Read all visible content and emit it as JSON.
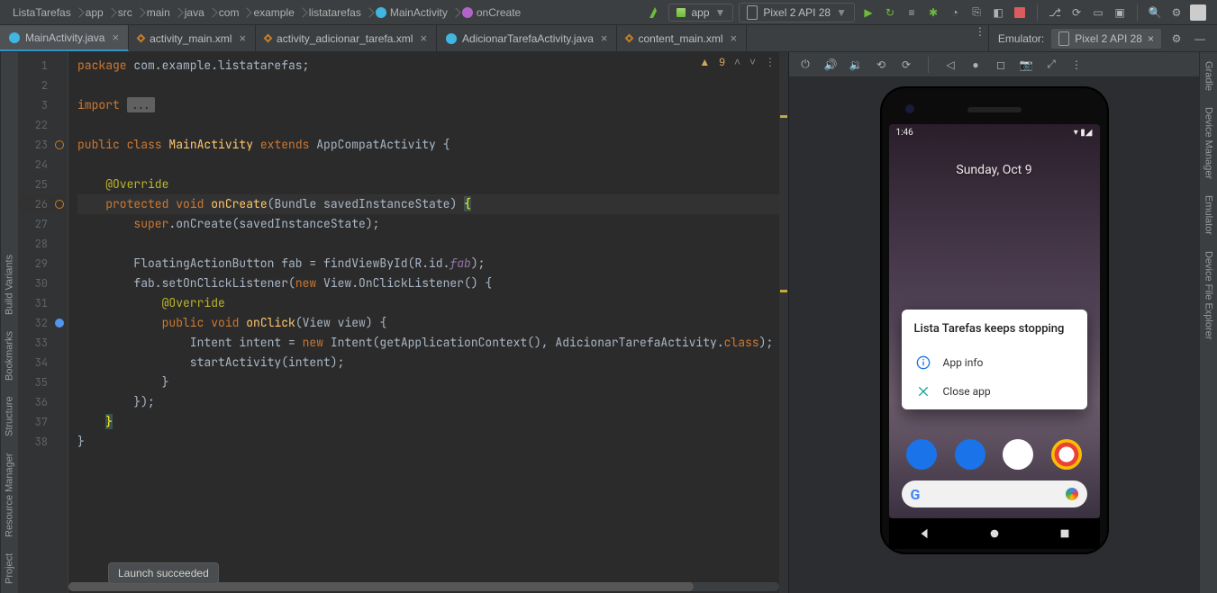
{
  "breadcrumbs": [
    "ListaTarefas",
    "app",
    "src",
    "main",
    "java",
    "com",
    "example",
    "listatarefas",
    "MainActivity",
    "onCreate"
  ],
  "runconfig": {
    "app": "app",
    "device": "Pixel 2 API 28"
  },
  "tabs": [
    {
      "label": "MainActivity.java",
      "kind": "java",
      "active": true
    },
    {
      "label": "activity_main.xml",
      "kind": "xml"
    },
    {
      "label": "activity_adicionar_tarefa.xml",
      "kind": "xml"
    },
    {
      "label": "AdicionarTarefaActivity.java",
      "kind": "java"
    },
    {
      "label": "content_main.xml",
      "kind": "xml"
    }
  ],
  "editor": {
    "warnings": "9",
    "lines": [
      {
        "n": "1",
        "html": "<span class='kw'>package</span> com.example.listatarefas;"
      },
      {
        "n": "2",
        "html": ""
      },
      {
        "n": "3",
        "html": "<span class='kw'>import</span> <span class='dots'>...</span>"
      },
      {
        "n": "22",
        "html": ""
      },
      {
        "n": "23",
        "html": "<span class='kw'>public class</span> <span class='fn'>MainActivity</span> <span class='kw'>extends</span> AppCompatActivity {",
        "mark": "o"
      },
      {
        "n": "24",
        "html": ""
      },
      {
        "n": "25",
        "html": "    <span class='ann'>@Override</span>"
      },
      {
        "n": "26",
        "html": "    <span class='kw'>protected</span> <span class='kw'>void</span> <span class='fn'>onCreate</span>(Bundle savedInstanceState) <span class='brace-y'>{</span>",
        "hl": true,
        "mark": "o"
      },
      {
        "n": "27",
        "html": "        <span class='kw'>super</span>.onCreate(savedInstanceState);"
      },
      {
        "n": "28",
        "html": ""
      },
      {
        "n": "29",
        "html": "        FloatingActionButton fab = findViewById(R.id.<span class='fld'>fab</span>);"
      },
      {
        "n": "30",
        "html": "        fab.setOnClickListener(<span class='kw'>new</span> View.OnClickListener() {"
      },
      {
        "n": "31",
        "html": "            <span class='ann'>@Override</span>"
      },
      {
        "n": "32",
        "html": "            <span class='kw'>public</span> <span class='kw'>void</span> <span class='fn'>onClick</span>(View view) {",
        "mark": "i"
      },
      {
        "n": "33",
        "html": "                Intent intent = <span class='kw'>new</span> Intent(getApplicationContext(), AdicionarTarefaActivity.<span class='kw'>class</span>);"
      },
      {
        "n": "34",
        "html": "                startActivity(intent);"
      },
      {
        "n": "35",
        "html": "            }"
      },
      {
        "n": "36",
        "html": "        });"
      },
      {
        "n": "37",
        "html": "    <span class='brace-y'>}</span>"
      },
      {
        "n": "38",
        "html": "}"
      }
    ]
  },
  "emulator": {
    "title": "Emulator:",
    "device": "Pixel 2 API 28",
    "status_time": "1:46",
    "date": "Sunday, Oct 9",
    "dialog": {
      "title": "Lista Tarefas keeps stopping",
      "info": "App info",
      "close": "Close app"
    }
  },
  "toast": "Launch succeeded",
  "leftrail": [
    "Project",
    "Resource Manager",
    "Structure",
    "Bookmarks",
    "Build Variants"
  ],
  "rightrail": [
    "Gradle",
    "Device Manager",
    "Emulator",
    "Device File Explorer"
  ]
}
